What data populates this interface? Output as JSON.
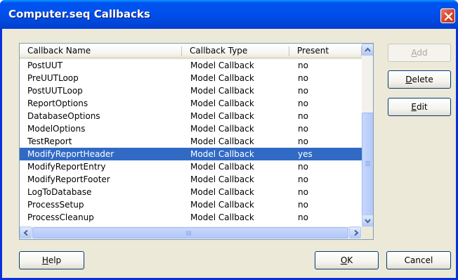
{
  "window": {
    "title": "Computer.seq Callbacks"
  },
  "listview": {
    "columns": [
      "Callback Name",
      "Callback Type",
      "Present"
    ],
    "selected_index": 7,
    "rows": [
      {
        "name": "PostUUT",
        "type": "Model Callback",
        "present": "no"
      },
      {
        "name": "PreUUTLoop",
        "type": "Model Callback",
        "present": "no"
      },
      {
        "name": "PostUUTLoop",
        "type": "Model Callback",
        "present": "no"
      },
      {
        "name": "ReportOptions",
        "type": "Model Callback",
        "present": "no"
      },
      {
        "name": "DatabaseOptions",
        "type": "Model Callback",
        "present": "no"
      },
      {
        "name": "ModelOptions",
        "type": "Model Callback",
        "present": "no"
      },
      {
        "name": "TestReport",
        "type": "Model Callback",
        "present": "no"
      },
      {
        "name": "ModifyReportHeader",
        "type": "Model Callback",
        "present": "yes"
      },
      {
        "name": "ModifyReportEntry",
        "type": "Model Callback",
        "present": "no"
      },
      {
        "name": "ModifyReportFooter",
        "type": "Model Callback",
        "present": "no"
      },
      {
        "name": "LogToDatabase",
        "type": "Model Callback",
        "present": "no"
      },
      {
        "name": "ProcessSetup",
        "type": "Model Callback",
        "present": "no"
      },
      {
        "name": "ProcessCleanup",
        "type": "Model Callback",
        "present": "no"
      }
    ]
  },
  "buttons": {
    "add": {
      "mnemonic": "A",
      "rest": "dd",
      "enabled": false
    },
    "delete": {
      "mnemonic": "D",
      "rest": "elete",
      "enabled": true
    },
    "edit": {
      "mnemonic": "E",
      "rest": "dit",
      "enabled": true
    },
    "help": {
      "mnemonic": "H",
      "rest": "elp",
      "enabled": true
    },
    "ok": {
      "mnemonic": "O",
      "rest": "K",
      "enabled": true
    },
    "cancel": {
      "label": "Cancel",
      "enabled": true
    }
  },
  "colors": {
    "titlebar": "#0054e3",
    "dialog_face": "#ece9d8",
    "selection": "#316ac5",
    "close_button": "#d9472b"
  },
  "icons": {
    "close": "close-icon",
    "scroll_up": "arrow-up-icon",
    "scroll_down": "arrow-down-icon",
    "scroll_left": "arrow-left-icon",
    "scroll_right": "arrow-right-icon"
  }
}
